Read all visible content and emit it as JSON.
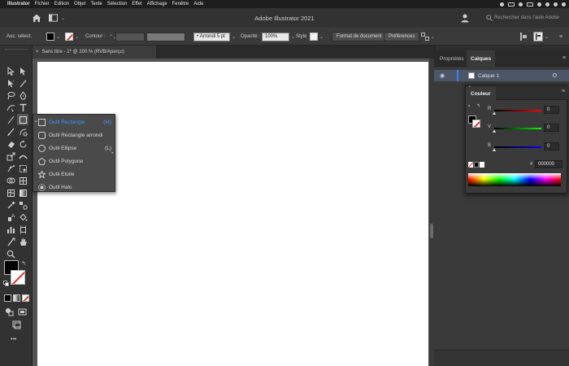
{
  "menubar": {
    "app": "Illustrator",
    "items": [
      "Fichier",
      "Edition",
      "Objet",
      "Texte",
      "Sélection",
      "Effet",
      "Affichage",
      "Fenêtre",
      "Aide"
    ]
  },
  "titlebar": {
    "title": "Adobe Illustrator 2021",
    "search_placeholder": "Rechercher dans l'aide Adobe"
  },
  "controlbar": {
    "selection_label": "Auc. sélect.",
    "stroke_label": "Contour :",
    "corner_label": "Arrondi 5 pt",
    "opacity_label": "Opacité :",
    "opacity_value": "100%",
    "style_label": "Style",
    "doc_format_button": "Format de document",
    "prefs_button": "Préférences"
  },
  "document": {
    "tab_title": "Sans titre - 1* @ 200 % (RVB/Aperçu)",
    "close_glyph": "×"
  },
  "flyout": {
    "items": [
      {
        "label": "Outil Rectangle",
        "key": "(M)",
        "selected": true
      },
      {
        "label": "Outil Rectangle arrondi",
        "key": ""
      },
      {
        "label": "Outil Ellipse",
        "key": "(L)"
      },
      {
        "label": "Outil Polygone",
        "key": ""
      },
      {
        "label": "Outil Etoile",
        "key": ""
      },
      {
        "label": "Outil Halo",
        "key": ""
      }
    ]
  },
  "panels": {
    "tabs": [
      "Propriétés",
      "Calques"
    ],
    "active_tab": "Calques",
    "layer_name": "Calque 1"
  },
  "color_panel": {
    "title": "Couleur",
    "channels": [
      {
        "label": "R",
        "value": "0"
      },
      {
        "label": "V",
        "value": "0"
      },
      {
        "label": "B",
        "value": "0"
      }
    ],
    "hex_label": "#",
    "hex_value": "000000"
  },
  "colors": {
    "accent": "#3f92ff",
    "none_slash": "#e0322b",
    "canvas": "#ffffff",
    "pasteboard": "#535353"
  },
  "icons": {
    "home": "home-icon",
    "workspace": "workspace-switcher-icon",
    "search": "search-icon",
    "user": "user-icon",
    "menu": "hamburger-menu-icon"
  },
  "toolbar": {
    "more_glyph": "•••"
  }
}
